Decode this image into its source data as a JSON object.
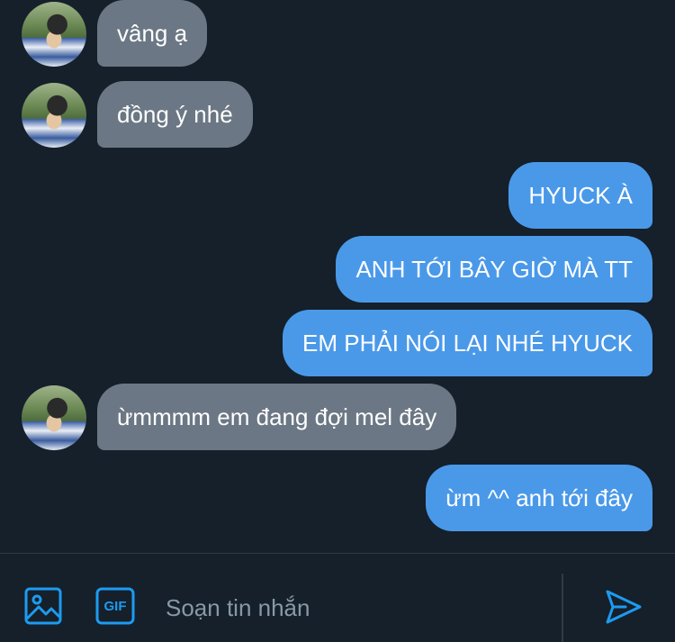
{
  "conversation": {
    "messages": [
      {
        "direction": "in",
        "text": "vâng ạ"
      },
      {
        "direction": "in",
        "text": "đồng ý nhé"
      },
      {
        "direction": "out",
        "text": "HYUCK À"
      },
      {
        "direction": "out",
        "text": "ANH TỚI BÂY GIỜ MÀ TT"
      },
      {
        "direction": "out",
        "text": "EM PHẢI NÓI LẠI NHÉ HYUCK"
      },
      {
        "direction": "in",
        "text": "ừmmmm em đang đợi mel đây"
      },
      {
        "direction": "out",
        "text": "ừm ^^ anh tới đây"
      }
    ]
  },
  "composer": {
    "placeholder": "Soạn tin nhắn",
    "image_icon": "image-icon",
    "gif_icon": "gif-icon",
    "gif_label": "GIF",
    "send_icon": "send-icon"
  },
  "colors": {
    "background": "#15202b",
    "incoming_bubble": "#6b7784",
    "outgoing_bubble": "#4a99e9",
    "accent": "#1d9bf0",
    "placeholder": "#8899a6"
  }
}
